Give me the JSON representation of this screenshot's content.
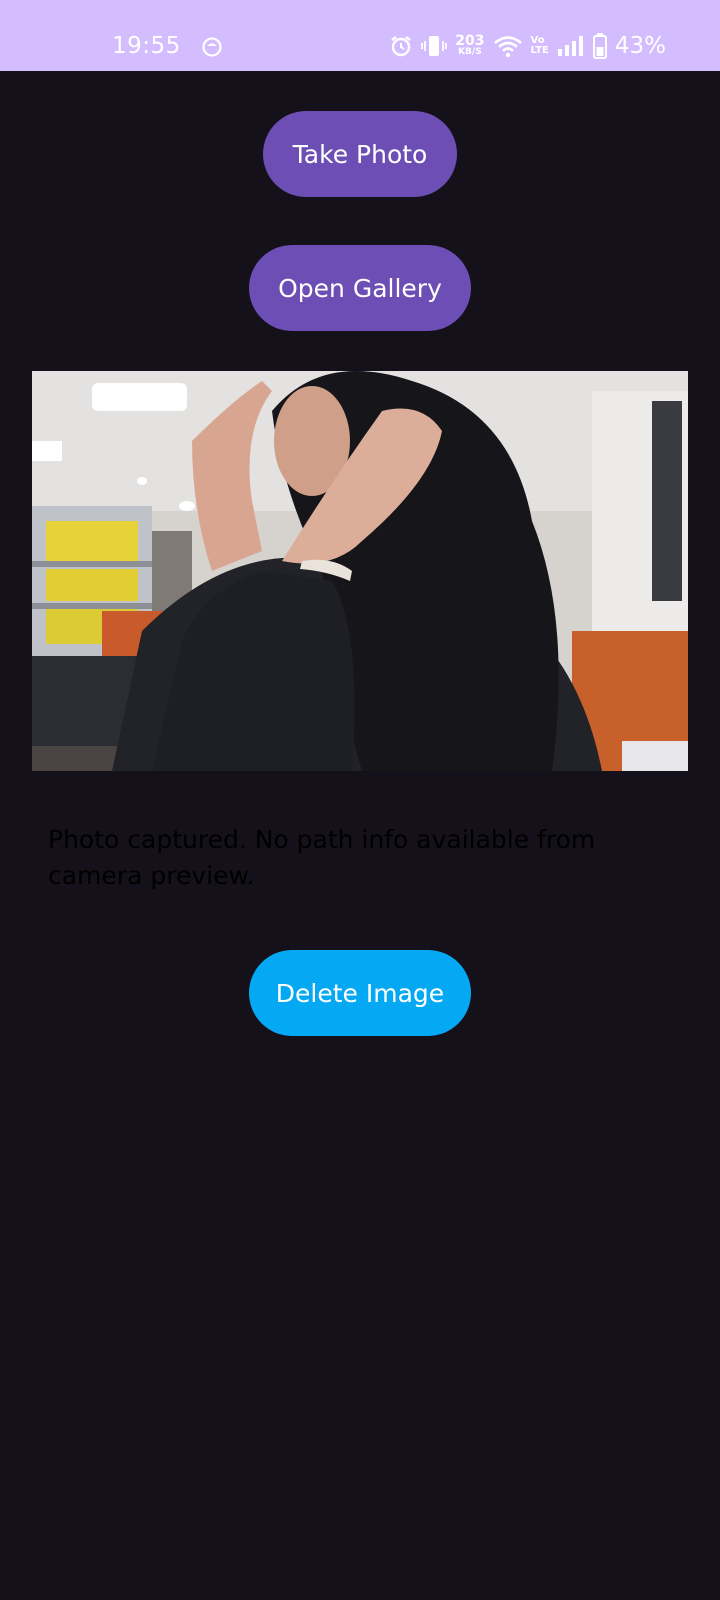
{
  "status_bar": {
    "time": "19:55",
    "net_speed_value": "203",
    "net_speed_unit": "KB/S",
    "volte_top": "Vo",
    "volte_bottom": "LTE",
    "battery_percent": "43%",
    "icons": [
      "app-notification-icon",
      "alarm-icon",
      "vibrate-icon",
      "wifi-icon",
      "signal-icon",
      "battery-icon"
    ],
    "background_color": "#d4bdfe"
  },
  "actions": {
    "take_photo_label": "Take Photo",
    "open_gallery_label": "Open Gallery",
    "delete_image_label": "Delete Image"
  },
  "preview": {
    "status_message": "Photo captured. No path info available from camera preview."
  },
  "colors": {
    "background": "#15111a",
    "primary_button": "#6c4eb4",
    "delete_button": "#05a8f3",
    "button_text": "#ffffff",
    "message_text": "#000000"
  }
}
